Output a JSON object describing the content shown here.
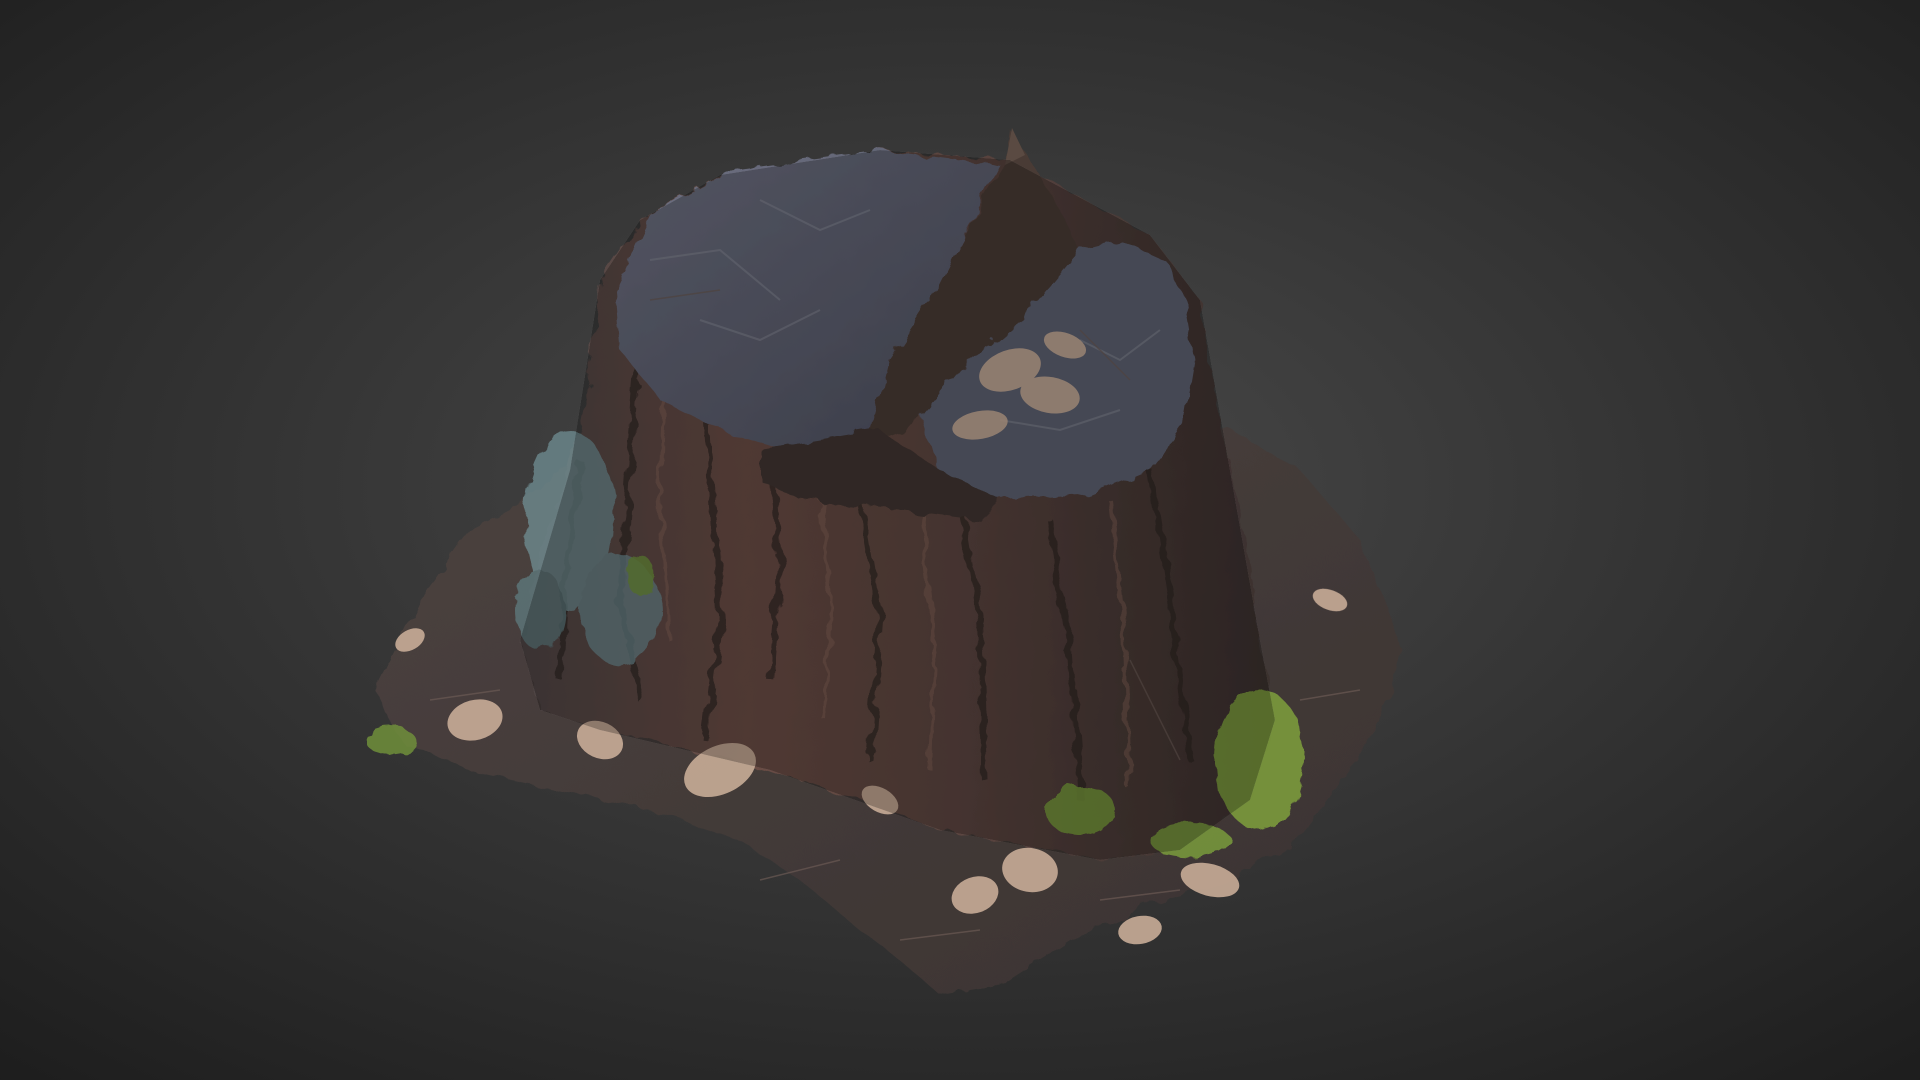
{
  "scene": {
    "subject": "tree-stump",
    "background_center": "#4a4a4a",
    "background_edge": "#1d1d1d",
    "colors": {
      "bark_dark": "#3c2f2c",
      "bark_mid": "#5e4640",
      "bark_light": "#7a5a50",
      "top_cut": "#5f6272",
      "top_cut_light": "#777a88",
      "moss": "#7fa03e",
      "lichen": "#6f8f94",
      "leaf": "#c9ad98",
      "ground": "#4f4542",
      "splinter": "#4a3b35"
    }
  }
}
